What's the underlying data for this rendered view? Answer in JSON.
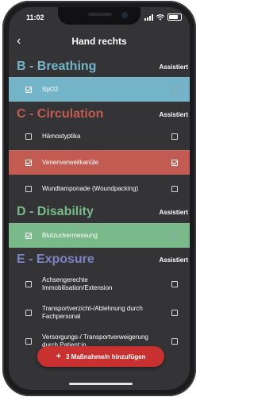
{
  "status": {
    "time": "11:02"
  },
  "header": {
    "back_icon": "‹",
    "title": "Hand rechts"
  },
  "colors": {
    "breathing": "#74b4c9",
    "circulation": "#c25b52",
    "disability": "#7ab98a",
    "exposure": "#7b84c6",
    "button": "#c8312f"
  },
  "sections": [
    {
      "title": "B - Breathing",
      "status": "Assistiert",
      "items": [
        {
          "label": "SpO2",
          "checked": true,
          "assisted": false,
          "highlighted": true
        }
      ]
    },
    {
      "title": "C - Circulation",
      "status": "Assistiert",
      "items": [
        {
          "label": "Hämostyptika",
          "checked": false,
          "assisted": false,
          "highlighted": false
        },
        {
          "label": "Venenverweilkanüle",
          "checked": true,
          "assisted": true,
          "highlighted": true
        },
        {
          "label": "Wundtamponade (Woundpacking)",
          "checked": false,
          "assisted": false,
          "highlighted": false
        }
      ]
    },
    {
      "title": "D - Disability",
      "status": "Assistiert",
      "items": [
        {
          "label": "Blutzuckermessung",
          "checked": true,
          "assisted": false,
          "highlighted": true
        }
      ]
    },
    {
      "title": "E - Exposure",
      "status": "Assistiert",
      "items": [
        {
          "label": "Achsengerechte Immobilisation/Extension",
          "checked": false,
          "assisted": false,
          "highlighted": false
        },
        {
          "label": "Transportverzicht-/Ablehnung durch Fachpersonal",
          "checked": false,
          "assisted": false,
          "highlighted": false
        },
        {
          "label": "Versorgungs-/ Transportverweigerung durch Patient:in",
          "checked": false,
          "assisted": false,
          "highlighted": false
        }
      ]
    }
  ],
  "add_button": {
    "label": "3 Maßnahme/n hinzufügen",
    "icon": "plus-icon"
  }
}
